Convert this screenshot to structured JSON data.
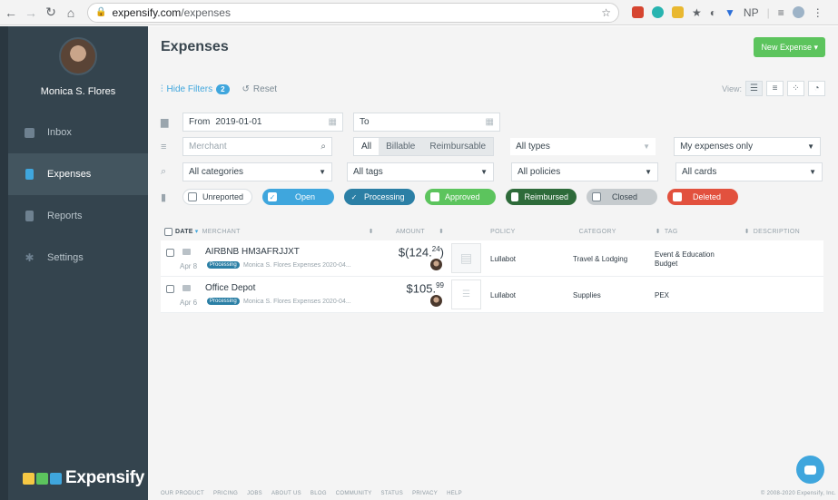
{
  "browser": {
    "url_host": "expensify.com",
    "url_path": "/expenses",
    "extensions": [
      "NP"
    ]
  },
  "sidebar": {
    "user_name": "Monica S. Flores",
    "items": [
      {
        "label": "Inbox",
        "icon": "inbox-icon",
        "active": false
      },
      {
        "label": "Expenses",
        "icon": "expenses-icon",
        "active": true
      },
      {
        "label": "Reports",
        "icon": "reports-icon",
        "active": false
      },
      {
        "label": "Settings",
        "icon": "gear-icon",
        "active": false
      }
    ],
    "brand": "Expensify"
  },
  "header": {
    "title": "Expenses",
    "new_button": "New Expense ▾"
  },
  "filters": {
    "hide_filters_label": "Hide Filters",
    "hide_filters_count": "2",
    "reset_label": "Reset",
    "view_label": "View:",
    "from_label": "From",
    "from_value": "2019-01-01",
    "to_label": "To",
    "to_value": "",
    "merchant_placeholder": "Merchant",
    "reimb_options": [
      "All",
      "Billable",
      "Reimbursable"
    ],
    "reimb_selected": "All",
    "types": "All types",
    "expenses_scope": "My expenses only",
    "categories": "All categories",
    "tags": "All tags",
    "policies": "All policies",
    "cards": "All cards",
    "statuses": [
      {
        "label": "Unreported",
        "checked": false,
        "color": "#ffffff"
      },
      {
        "label": "Open",
        "checked": true,
        "color": "#3fa6dd"
      },
      {
        "label": "Processing",
        "checked": true,
        "color": "#2b7fa5"
      },
      {
        "label": "Approved",
        "checked": false,
        "color": "#5cc45d"
      },
      {
        "label": "Reimbursed",
        "checked": false,
        "color": "#2e6b3a"
      },
      {
        "label": "Closed",
        "checked": false,
        "color": "#c6cbce"
      },
      {
        "label": "Deleted",
        "checked": false,
        "color": "#e2513e"
      }
    ]
  },
  "table": {
    "headers": {
      "date": "DATE",
      "merchant": "MERCHANT",
      "amount": "AMOUNT",
      "policy": "POLICY",
      "category": "CATEGORY",
      "tag": "TAG",
      "description": "DESCRIPTION"
    },
    "rows": [
      {
        "merchant": "AIRBNB HM3AFRJJXT",
        "date": "Apr 8",
        "status": "Processing",
        "report": "Monica S. Flores Expenses 2020-04...",
        "amount_main": "$(124.",
        "amount_cents": "24",
        "amount_suffix": ")",
        "policy": "Lullabot",
        "category": "Travel & Lodging",
        "tag_line1": "Event & Education",
        "tag_line2": "Budget"
      },
      {
        "merchant": "Office Depot",
        "date": "Apr 6",
        "status": "Processing",
        "report": "Monica S. Flores Expenses 2020-04...",
        "amount_main": "$105.",
        "amount_cents": "99",
        "amount_suffix": "",
        "policy": "Lullabot",
        "category": "Supplies",
        "tag_line1": "PEX",
        "tag_line2": ""
      }
    ]
  },
  "footer": {
    "links": [
      "OUR PRODUCT",
      "PRICING",
      "JOBS",
      "ABOUT US",
      "BLOG",
      "COMMUNITY",
      "STATUS",
      "PRIVACY",
      "HELP"
    ],
    "copyright": "© 2008-2020 Expensify, Inc."
  }
}
